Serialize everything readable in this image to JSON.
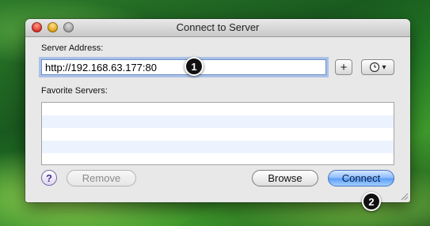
{
  "window": {
    "title": "Connect to Server"
  },
  "server_address": {
    "label": "Server Address:",
    "value": "http://192.168.63.177:80"
  },
  "add_button": {
    "label": "+",
    "icon": "plus-icon"
  },
  "recent_button": {
    "icon": "clock-icon",
    "label": "▾"
  },
  "favorites": {
    "label": "Favorite Servers:",
    "items": [
      "",
      "",
      "",
      "",
      ""
    ]
  },
  "footer": {
    "help_label": "?",
    "remove_label": "Remove",
    "browse_label": "Browse",
    "connect_label": "Connect"
  },
  "annotations": {
    "step1": "1",
    "step2": "2"
  },
  "colors": {
    "accent": "#5d9cf5",
    "focus_ring": "#78a0e6",
    "list_stripe": "#edf3fe",
    "desktop": "#2c7a2a"
  }
}
